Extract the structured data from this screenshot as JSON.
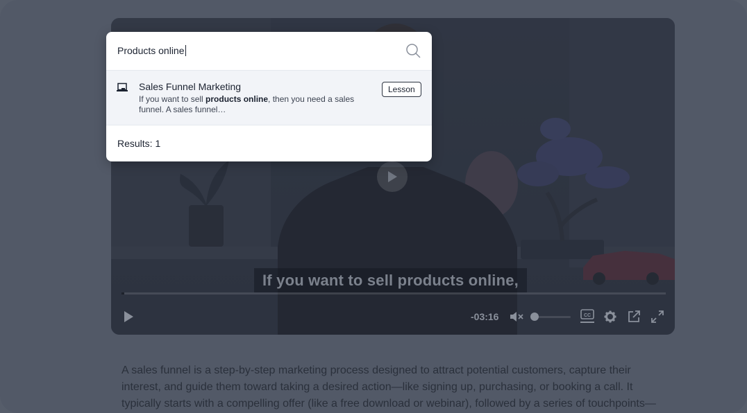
{
  "search": {
    "query": "Products online",
    "results": [
      {
        "title": "Sales Funnel Marketing",
        "snippet_before": "If you want to sell ",
        "snippet_highlight": "products online",
        "snippet_after": ", then you need a sales funnel. A sales funnel…",
        "type": "Lesson",
        "icon": "laptop-icon"
      }
    ],
    "results_count": "Results: 1"
  },
  "video": {
    "caption": "If you want to sell products online,",
    "time_remaining": "-03:16",
    "progress": 0.005,
    "volume": 0,
    "muted": true
  },
  "article": {
    "text": "A sales funnel is a step-by-step marketing process designed to attract potential customers, capture their interest, and guide them toward taking a desired action—like signing up, purchasing, or booking a call. It typically starts with a compelling offer (like a free download or webinar), followed by a series of touchpoints—"
  }
}
